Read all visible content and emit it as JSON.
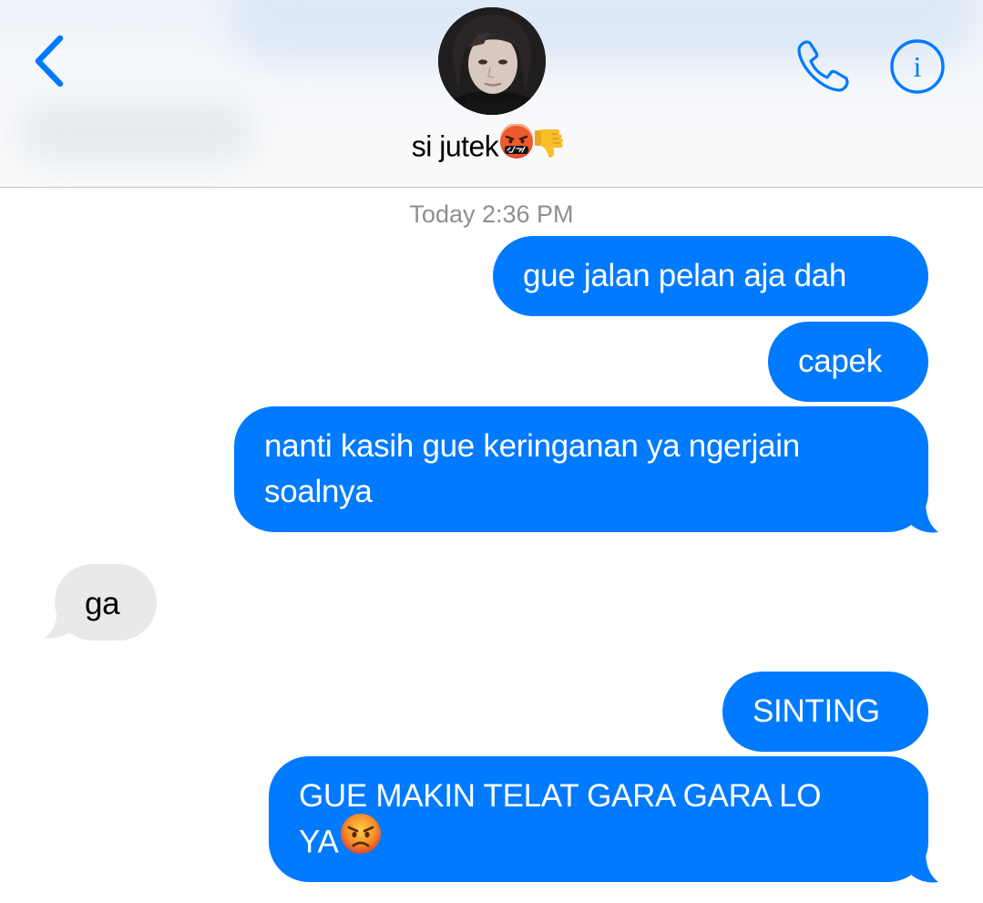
{
  "header": {
    "contact_name": "si jutek",
    "name_emojis": [
      "cursing-face-emoji",
      "thumbs-down-emoji"
    ],
    "back_icon": "chevron-left-icon",
    "phone_icon": "phone-icon",
    "info_icon": "info-icon",
    "info_glyph": "i"
  },
  "thread": {
    "timestamp_day": "Today",
    "timestamp_time": "2:36 PM",
    "messages": [
      {
        "direction": "sent",
        "text": "gue jalan pelan aja dah"
      },
      {
        "direction": "sent",
        "text": "capek"
      },
      {
        "direction": "sent",
        "text": "nanti kasih gue keringanan ya ngerjain",
        "text_line2": "soalnya"
      },
      {
        "direction": "received",
        "text": "ga"
      },
      {
        "direction": "sent",
        "text": "SINTING"
      },
      {
        "direction": "sent",
        "text": "GUE MAKIN TELAT GARA GARA LO",
        "text_line2": "YA",
        "emoji": "angry-face-emoji"
      }
    ]
  },
  "colors": {
    "accent": "#007aff",
    "sent_bubble": "#007aff",
    "received_bubble": "#e9e9eb",
    "timestamp_text": "#8e8e93",
    "divider": "#c6c6c8"
  }
}
